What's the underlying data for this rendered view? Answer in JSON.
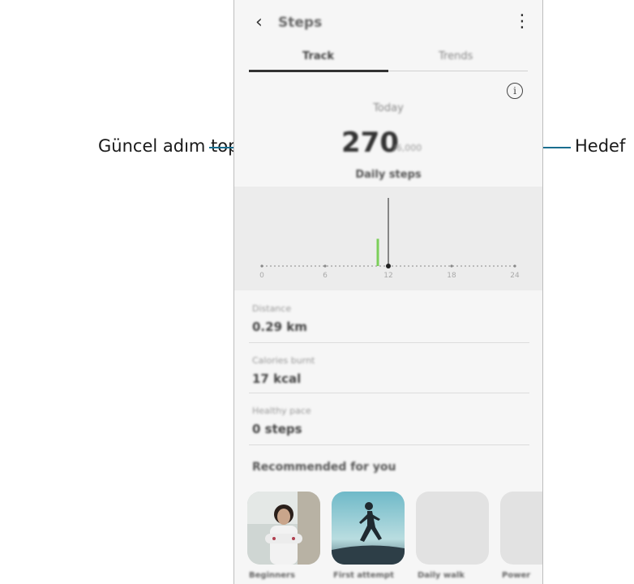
{
  "callouts": {
    "left": "Güncel adım toplamı",
    "right": "Hedef"
  },
  "header": {
    "back_icon": "chevron-left-icon",
    "title": "Steps",
    "more_icon": "more-vertical-icon"
  },
  "tabs": [
    {
      "label": "Track",
      "active": true
    },
    {
      "label": "Trends",
      "active": false
    }
  ],
  "summary": {
    "info_icon": "info-icon",
    "info_glyph": "i",
    "period": "Today",
    "steps": "270",
    "target": "/6,000",
    "caption": "Daily steps"
  },
  "chart_data": {
    "type": "bar",
    "x_ticks": [
      "0",
      "6",
      "12",
      "18",
      "24"
    ],
    "bars": [
      {
        "x_hour": 11.0,
        "value": 40,
        "color": "#7ccf5a"
      }
    ],
    "current_time_marker_hour": 12,
    "colors": {
      "bar": "#7ccf5a",
      "marker": "#222222",
      "baseline": "#888888"
    }
  },
  "stats": [
    {
      "label": "Distance",
      "value": "0.29 km"
    },
    {
      "label": "Calories burnt",
      "value": "17 kcal"
    },
    {
      "label": "Healthy pace",
      "value": "0 steps"
    }
  ],
  "recommended": {
    "title": "Recommended for you",
    "items": [
      {
        "label": "Beginners",
        "image": "woman-portrait-photo"
      },
      {
        "label": "First attempt",
        "image": "runner-silhouette-photo"
      },
      {
        "label": "Daily walk",
        "image": "placeholder"
      },
      {
        "label": "Power",
        "image": "placeholder"
      }
    ]
  }
}
